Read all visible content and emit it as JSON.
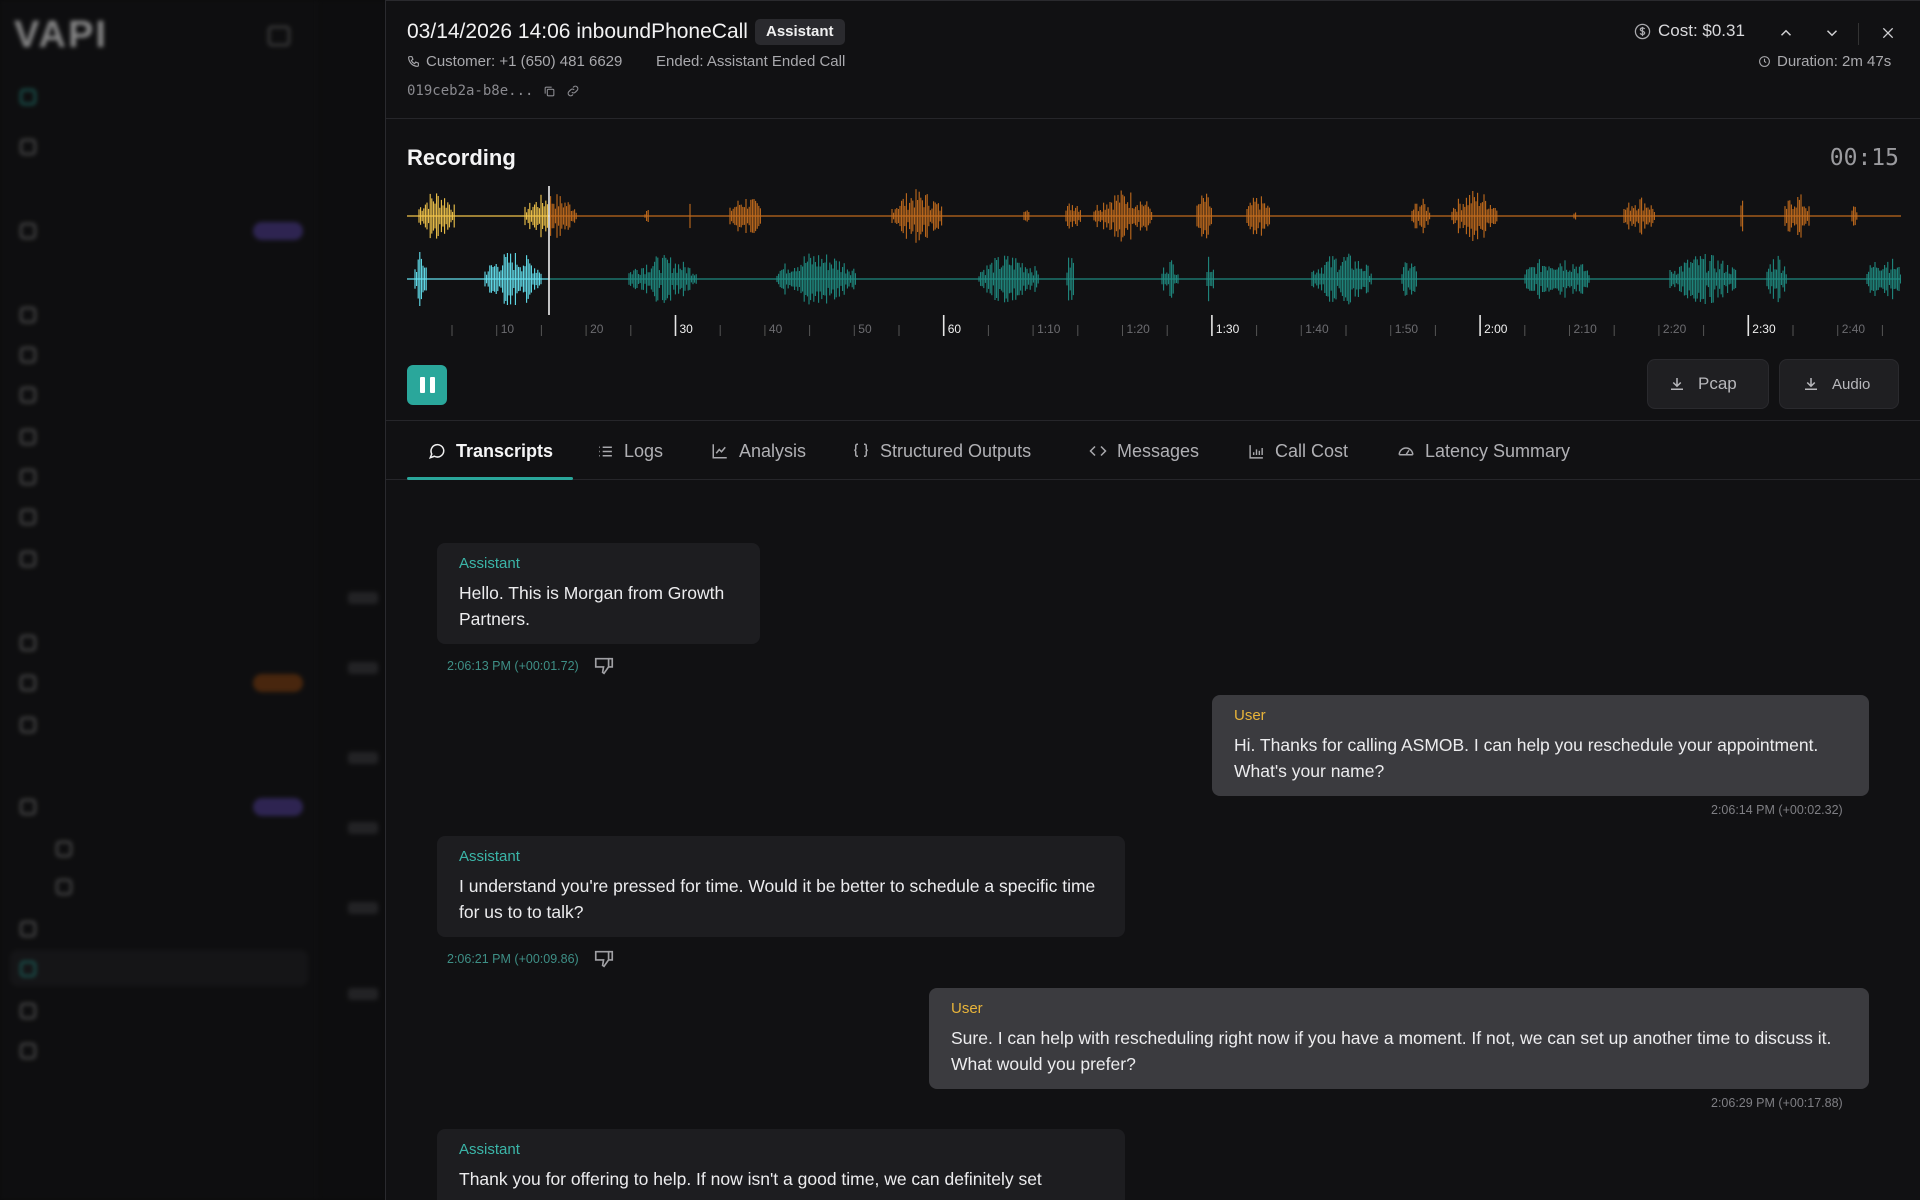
{
  "sidebar": {
    "logo": "VAPI"
  },
  "header": {
    "title": "03/14/2026 14:06 inboundPhoneCall",
    "badge": "Assistant",
    "customer": "Customer: +1 (650) 481 6629",
    "ended": "Ended: Assistant Ended Call",
    "call_id": "019ceb2a-b8e...",
    "cost": "Cost: $0.31",
    "duration": "Duration: 2m 47s"
  },
  "recording": {
    "title": "Recording",
    "time": "00:15",
    "ticks": [
      "10",
      "20",
      "30",
      "40",
      "50",
      "60",
      "1:10",
      "1:20",
      "1:30",
      "1:40",
      "1:50",
      "2:00",
      "2:10",
      "2:20",
      "2:30",
      "2:40"
    ],
    "major_ticks": [
      "30",
      "60",
      "1:30",
      "2:00",
      "2:30"
    ],
    "pcap_label": "Pcap",
    "audio_label": "Audio",
    "colors": {
      "assistant_played": "#f1c44a",
      "assistant": "#c06a1c",
      "user_played": "#63e0ee",
      "user": "#1f8a80"
    }
  },
  "tabs": [
    {
      "label": "Transcripts",
      "icon": "chat-icon"
    },
    {
      "label": "Logs",
      "icon": "list-icon"
    },
    {
      "label": "Analysis",
      "icon": "chart-icon"
    },
    {
      "label": "Structured Outputs",
      "icon": "braces-icon"
    },
    {
      "label": "Messages",
      "icon": "code-icon"
    },
    {
      "label": "Call Cost",
      "icon": "bar-chart-icon"
    },
    {
      "label": "Latency Summary",
      "icon": "gauge-icon"
    }
  ],
  "messages": [
    {
      "role": "Assistant",
      "text": "Hello. This is Morgan from Growth Partners.",
      "time": "2:06:13 PM",
      "offset": "(+00:01.72)"
    },
    {
      "role": "User",
      "text": "Hi. Thanks for calling ASMOB. I can help you reschedule your appointment. What's your name?",
      "time": "2:06:14 PM",
      "offset": "(+00:02.32)"
    },
    {
      "role": "Assistant",
      "text": "I understand you're pressed for time. Would it be better to schedule a specific time for us to to talk?",
      "time": "2:06:21 PM",
      "offset": "(+00:09.86)"
    },
    {
      "role": "User",
      "text": "Sure. I can help with rescheduling right now if you have a moment. If not, we can set up another time to discuss it. What would you prefer?",
      "time": "2:06:29 PM",
      "offset": "(+00:17.88)"
    },
    {
      "role": "Assistant",
      "text": "Thank you for offering to help. If now isn't a good time, we can definitely set",
      "time": "",
      "offset": ""
    }
  ]
}
